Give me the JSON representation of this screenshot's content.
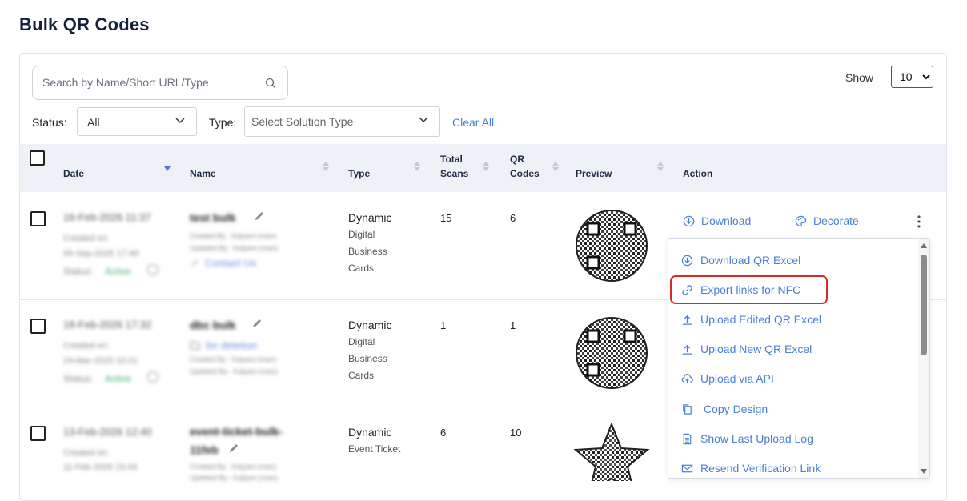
{
  "page": {
    "title": "Bulk QR Codes"
  },
  "search": {
    "placeholder": "Search by Name/Short URL/Type"
  },
  "show": {
    "label": "Show",
    "value": "10"
  },
  "filters": {
    "status_label": "Status:",
    "status_value": "All",
    "type_label": "Type:",
    "type_placeholder": "Select Solution Type",
    "clear_all": "Clear All"
  },
  "table": {
    "headers": {
      "date": "Date",
      "name": "Name",
      "type": "Type",
      "total_scans_1": "Total",
      "total_scans_2": "Scans",
      "qr_codes_1": "QR",
      "qr_codes_2": "Codes",
      "preview": "Preview",
      "action": "Action"
    },
    "rows": [
      {
        "date": "16-Feb-2026 11:37",
        "created_label": "Created on:",
        "created": "05-Sep-2025 17:49",
        "status_label": "Status:",
        "status": "Active",
        "name": "test bulk",
        "created_by": "Created By : Kalyani (man)",
        "updated_by": "Updated By : Kalyani (man)",
        "folder": "Contact Us",
        "type": "Dynamic",
        "subtype": [
          "Digital",
          "Business",
          "Cards"
        ],
        "total_scans": "15",
        "qr_codes": "6"
      },
      {
        "date": "18-Feb-2026 17:32",
        "created_label": "Created on:",
        "created": "24-Mar-2025 10:21",
        "status_label": "Status:",
        "status": "Active",
        "name": "dbc bulk",
        "folder": "for deletion",
        "created_by": "Created By : Kalyani (man)",
        "updated_by": "Updated By : Kalyani (man)",
        "type": "Dynamic",
        "subtype": [
          "Digital",
          "Business",
          "Cards"
        ],
        "total_scans": "1",
        "qr_codes": "1"
      },
      {
        "date": "13-Feb-2026 12:40",
        "created_label": "Created on:",
        "created": "11-Feb-2026 15:43",
        "name_1": "event-ticket-bulk-",
        "name_2": "11feb",
        "created_by": "Created By : Kalyani (man)",
        "updated_by": "Updated By : Kalyani (man)",
        "type": "Dynamic",
        "subtype": [
          "Event Ticket"
        ],
        "total_scans": "6",
        "qr_codes": "10"
      }
    ]
  },
  "actions": {
    "download": "Download",
    "decorate": "Decorate"
  },
  "menu": {
    "items": [
      {
        "label": "Download QR Excel",
        "icon": "download-circle-icon"
      },
      {
        "label": "Export links for NFC",
        "icon": "link-icon"
      },
      {
        "label": "Upload Edited QR Excel",
        "icon": "upload-icon"
      },
      {
        "label": "Upload New QR Excel",
        "icon": "upload-icon"
      },
      {
        "label": "Upload via API",
        "icon": "cloud-upload-icon"
      },
      {
        "label": "Copy Design",
        "icon": "copy-icon"
      },
      {
        "label": "Show Last Upload Log",
        "icon": "document-icon"
      },
      {
        "label": "Resend Verification Link",
        "icon": "mail-icon"
      }
    ]
  },
  "colors": {
    "link": "#4a7fd8",
    "highlight": "#e0262b",
    "header_bg": "#eef1f6",
    "title": "#14213d"
  }
}
